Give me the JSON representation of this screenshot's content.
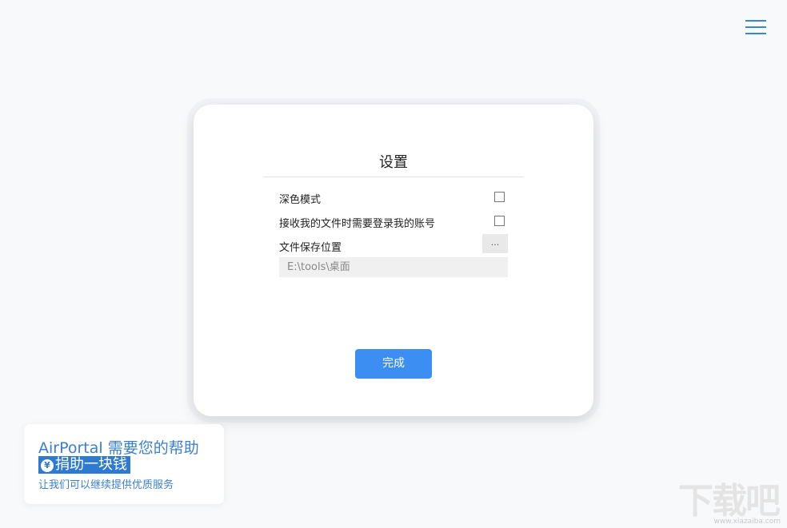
{
  "header": {
    "menu_icon": "hamburger-menu-icon",
    "accent_color": "#3a86d6"
  },
  "settings": {
    "title": "设置",
    "dark_mode_label": "深色模式",
    "dark_mode_checked": false,
    "require_login_label": "接收我的文件时需要登录我的账号",
    "require_login_checked": false,
    "save_location_label": "文件保存位置",
    "browse_label": "...",
    "save_path": "E:\\tools\\桌面",
    "done_label": "完成",
    "done_color": "#3d8ef2"
  },
  "donate": {
    "title": "AirPortal 需要您的帮助",
    "button_icon": "yen-icon",
    "button_label": "捐助一块钱",
    "subtitle": "让我们可以继续提供优质服务",
    "color": "#2e7ad1"
  },
  "watermark": {
    "logo_text": "下载吧",
    "url_text": "www.xiazaiba.com"
  }
}
